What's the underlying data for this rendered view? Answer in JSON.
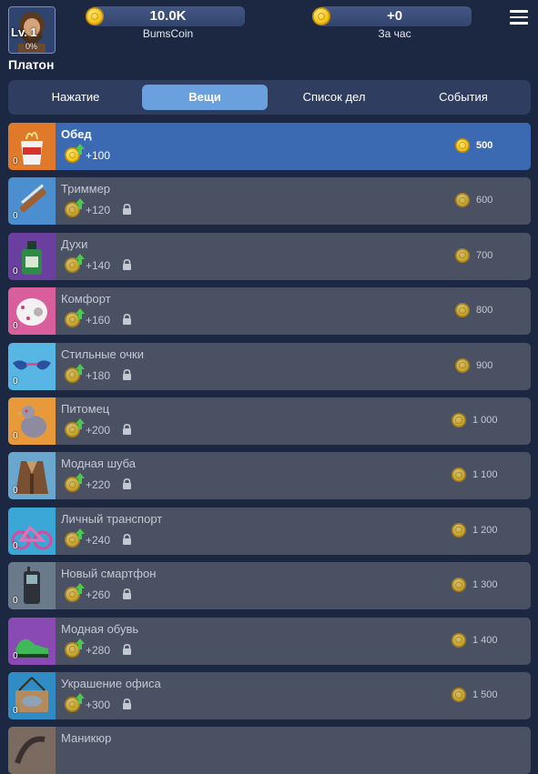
{
  "profile": {
    "level": "Lv. 1",
    "progress": "0%",
    "name": "Платон"
  },
  "stats": [
    {
      "value": "10.0K",
      "label": "BumsCoin"
    },
    {
      "value": "+0",
      "label": "За час"
    }
  ],
  "tabs": [
    {
      "label": "Нажатие",
      "active": false
    },
    {
      "label": "Вещи",
      "active": true
    },
    {
      "label": "Список дел",
      "active": false
    },
    {
      "label": "События",
      "active": false
    }
  ],
  "items": [
    {
      "name": "Обед",
      "count": "0",
      "income": "+100",
      "price": "500",
      "locked": false,
      "icon": "noodle-cup-icon"
    },
    {
      "name": "Триммер",
      "count": "0",
      "income": "+120",
      "price": "600",
      "locked": true,
      "icon": "trimmer-icon"
    },
    {
      "name": "Духи",
      "count": "0",
      "income": "+140",
      "price": "700",
      "locked": true,
      "icon": "perfume-icon"
    },
    {
      "name": "Комфорт",
      "count": "0",
      "income": "+160",
      "price": "800",
      "locked": true,
      "icon": "toilet-paper-icon"
    },
    {
      "name": "Стильные очки",
      "count": "0",
      "income": "+180",
      "price": "900",
      "locked": true,
      "icon": "glasses-icon"
    },
    {
      "name": "Питомец",
      "count": "0",
      "income": "+200",
      "price": "1 000",
      "locked": true,
      "icon": "pigeon-icon"
    },
    {
      "name": "Модная шуба",
      "count": "0",
      "income": "+220",
      "price": "1 100",
      "locked": true,
      "icon": "fur-coat-icon"
    },
    {
      "name": "Личный транспорт",
      "count": "0",
      "income": "+240",
      "price": "1 200",
      "locked": true,
      "icon": "bicycle-icon"
    },
    {
      "name": "Новый смартфон",
      "count": "0",
      "income": "+260",
      "price": "1 300",
      "locked": true,
      "icon": "phone-icon"
    },
    {
      "name": "Модная обувь",
      "count": "0",
      "income": "+280",
      "price": "1 400",
      "locked": true,
      "icon": "shoe-icon"
    },
    {
      "name": "Украшение офиса",
      "count": "0",
      "income": "+300",
      "price": "1 500",
      "locked": true,
      "icon": "fish-sign-icon"
    },
    {
      "name": "Маникюр",
      "count": "",
      "income": "",
      "price": "",
      "locked": true,
      "icon": "manicure-icon"
    }
  ],
  "colors": {
    "background": "#1c2742",
    "activeItem": "#3b6ab3",
    "lockedItem": "#4a5163",
    "activeTab": "#6aa0dd",
    "coin": "#f3c21a"
  }
}
